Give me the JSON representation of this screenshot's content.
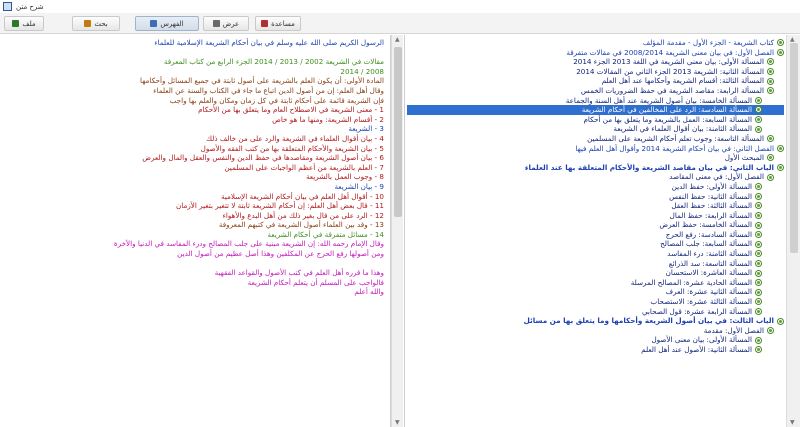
{
  "window": {
    "title": "شرح متن"
  },
  "toolbar": {
    "buttons": [
      {
        "label": "ملف",
        "color": "#2a7a2a"
      },
      {
        "label": "بحث",
        "color": "#c07a10"
      },
      {
        "label": "الفهرس",
        "color": "#3a6fb5"
      },
      {
        "label": "عرض",
        "color": "#6a6a6a"
      },
      {
        "label": "مساعدة",
        "color": "#b03030"
      }
    ]
  },
  "colors": {
    "accent": "#1c3fb0",
    "highlight": "#2f6fcf",
    "heading_green": "#3e8f1f",
    "pink": "#c218b8",
    "red": "#b01818"
  },
  "left_doc": {
    "lines": [
      {
        "text": "الرسول الكريم صلى الله عليه وسلم في بيان أحكام الشريعة الإسلامية للعلماء",
        "color": "c-blue"
      },
      {
        "text": "",
        "color": "c-blue"
      },
      {
        "text": "مقالات في الشريعة 2002 / 2013 / 2014 الجزء الرابع من كتاب المعرفة",
        "color": "c-green"
      },
      {
        "text": "2008 / 2014",
        "color": "c-green"
      },
      {
        "text": "المادة الأولى: أن يكون العلم بالشريعة على أصول ثابتة في جميع المسائل وأحكامها",
        "color": "c-brown"
      },
      {
        "text": "وقال أهل العلم: إن من أصول الدين اتباع ما جاء في الكتاب والسنة عن العلماء",
        "color": "c-brown"
      },
      {
        "text": "فإن الشريعة قائمة على أحكام ثابتة في كل زمان ومكان والعلم بها واجب",
        "color": "c-brown"
      },
      {
        "text": "1 - معنى الشريعة في الاصطلاح العام وما يتعلق بها من الأحكام",
        "color": "c-red"
      },
      {
        "text": "2 - أقسام الشريعة: ومنها ما هو خاص",
        "color": "c-red"
      },
      {
        "text": "3 - الشريعة",
        "color": "c-blue"
      },
      {
        "text": "4 - بيان أقوال العلماء في الشريعة والرد على من خالف ذلك",
        "color": "c-red"
      },
      {
        "text": "5 - بيان الشريعة والأحكام المتعلقة بها من كتب الفقه والأصول",
        "color": "c-red"
      },
      {
        "text": "6 - بيان أصول الشريعة ومقاصدها في حفظ الدين والنفس والعقل والمال والعرض",
        "color": "c-red"
      },
      {
        "text": "7 - العلم بالشريعة من أعظم الواجبات على المسلمين",
        "color": "c-red"
      },
      {
        "text": "8 - وجوب العمل بالشريعة",
        "color": "c-red"
      },
      {
        "text": "9 - بيان الشريعة",
        "color": "c-blue"
      },
      {
        "text": "10 - أقوال أهل العلم في بيان أحكام الشريعة الإسلامية",
        "color": "c-red"
      },
      {
        "text": "11 - قال بعض أهل العلم: إن أحكام الشريعة ثابتة لا تتغير بتغير الأزمان",
        "color": "c-red"
      },
      {
        "text": "12 - الرد على من قال بغير ذلك من أهل البدع والأهواء",
        "color": "c-red"
      },
      {
        "text": "13 - وقد بين العلماء أصول الشريعة في كتبهم المعروفة",
        "color": "c-brown"
      },
      {
        "text": "14 - مسائل متفرقة في أحكام الشريعة",
        "color": "c-green"
      },
      {
        "text": "وقال الإمام رحمه الله: إن الشريعة مبنية على جلب المصالح ودرء المفاسد في الدنيا والآخرة",
        "color": "c-pink"
      },
      {
        "text": "ومن أصولها رفع الحرج عن المكلفين وهذا أصل عظيم من أصول الدين",
        "color": "c-pink"
      },
      {
        "text": "",
        "color": "c-pink"
      },
      {
        "text": "وهذا ما قرره أهل العلم في كتب الأصول والقواعد الفقهية",
        "color": "c-pink"
      },
      {
        "text": "فالواجب على المسلم أن يتعلم أحكام الشريعة",
        "color": "c-pink"
      },
      {
        "text": "والله أعلم",
        "color": "c-pink"
      }
    ]
  },
  "right_tree": {
    "items": [
      {
        "text": "كتاب الشريعة - الجزء الأول - مقدمة المؤلف",
        "level": 0,
        "color": "c-blue"
      },
      {
        "text": "الفصل الأول: في بيان معنى الشريعة 2008/2014 في مقالات متفرقة",
        "level": 0,
        "color": "c-blue"
      },
      {
        "text": "المسألة الأولى: بيان معنى الشريعة في اللغة 2013 الجزء 2014",
        "level": 1,
        "color": "c-dblue"
      },
      {
        "text": "المسألة الثانية: الشريعة 2013 الجزء الثاني من المقالات 2014",
        "level": 1,
        "color": "c-dblue"
      },
      {
        "text": "المسألة الثالثة: أقسام الشريعة وأحكامها عند أهل العلم",
        "level": 1,
        "color": "c-dblue"
      },
      {
        "text": "المسألة الرابعة: مقاصد الشريعة في حفظ الضروريات الخمس",
        "level": 1,
        "color": "c-dblue"
      },
      {
        "text": "المسألة الخامسة: بيان أصول الشريعة عند أهل السنة والجماعة",
        "level": 2,
        "color": "c-dblue"
      },
      {
        "text": "المسألة السادسة: الرد على المخالفين في أحكام الشريعة",
        "level": 2,
        "color": "c-dblue",
        "highlight": true
      },
      {
        "text": "المسألة السابعة: العمل بالشريعة وما يتعلق بها من أحكام",
        "level": 2,
        "color": "c-dblue"
      },
      {
        "text": "المسألة الثامنة: بيان أقوال العلماء في الشريعة",
        "level": 2,
        "color": "c-dblue"
      },
      {
        "text": "المسألة التاسعة: وجوب تعلم أحكام الشريعة على المسلمين",
        "level": 1,
        "color": "c-dblue"
      },
      {
        "text": "الفصل الثاني: في بيان أحكام الشريعة 2014 وأقوال أهل العلم فيها",
        "level": 0,
        "color": "c-blue"
      },
      {
        "text": "المبحث الأول",
        "level": 1,
        "color": "c-dblue"
      },
      {
        "text": "الباب الثاني: في بيان مقاصد الشريعة والأحكام المتعلقة بها عند العلماء",
        "level": 0,
        "color": "c-blue",
        "bold": true
      },
      {
        "text": "الفصل الأول: في معنى المقاصد",
        "level": 1,
        "color": "c-dblue"
      },
      {
        "text": "المسألة الأولى: حفظ الدين",
        "level": 2,
        "color": "c-dblue"
      },
      {
        "text": "المسألة الثانية: حفظ النفس",
        "level": 2,
        "color": "c-dblue"
      },
      {
        "text": "المسألة الثالثة: حفظ العقل",
        "level": 2,
        "color": "c-dblue"
      },
      {
        "text": "المسألة الرابعة: حفظ المال",
        "level": 2,
        "color": "c-dblue"
      },
      {
        "text": "المسألة الخامسة: حفظ العرض",
        "level": 2,
        "color": "c-dblue"
      },
      {
        "text": "المسألة السادسة: رفع الحرج",
        "level": 2,
        "color": "c-dblue"
      },
      {
        "text": "المسألة السابعة: جلب المصالح",
        "level": 2,
        "color": "c-dblue"
      },
      {
        "text": "المسألة الثامنة: درء المفاسد",
        "level": 2,
        "color": "c-dblue"
      },
      {
        "text": "المسألة التاسعة: سد الذرائع",
        "level": 2,
        "color": "c-dblue"
      },
      {
        "text": "المسألة العاشرة: الاستحسان",
        "level": 2,
        "color": "c-dblue"
      },
      {
        "text": "المسألة الحادية عشرة: المصالح المرسلة",
        "level": 2,
        "color": "c-dblue"
      },
      {
        "text": "المسألة الثانية عشرة: العرف",
        "level": 2,
        "color": "c-dblue"
      },
      {
        "text": "المسألة الثالثة عشرة: الاستصحاب",
        "level": 2,
        "color": "c-dblue"
      },
      {
        "text": "المسألة الرابعة عشرة: قول الصحابي",
        "level": 2,
        "color": "c-dblue"
      },
      {
        "text": "الباب الثالث: في بيان أصول الشريعة وأحكامها وما يتعلق بها من مسائل",
        "level": 0,
        "color": "c-blue",
        "bold": true
      },
      {
        "text": "الفصل الأول: مقدمة",
        "level": 1,
        "color": "c-dblue"
      },
      {
        "text": "المسألة الأولى: بيان معنى الأصول",
        "level": 2,
        "color": "c-dblue"
      },
      {
        "text": "المسألة الثانية: الأصول عند أهل العلم",
        "level": 2,
        "color": "c-dblue"
      }
    ]
  }
}
